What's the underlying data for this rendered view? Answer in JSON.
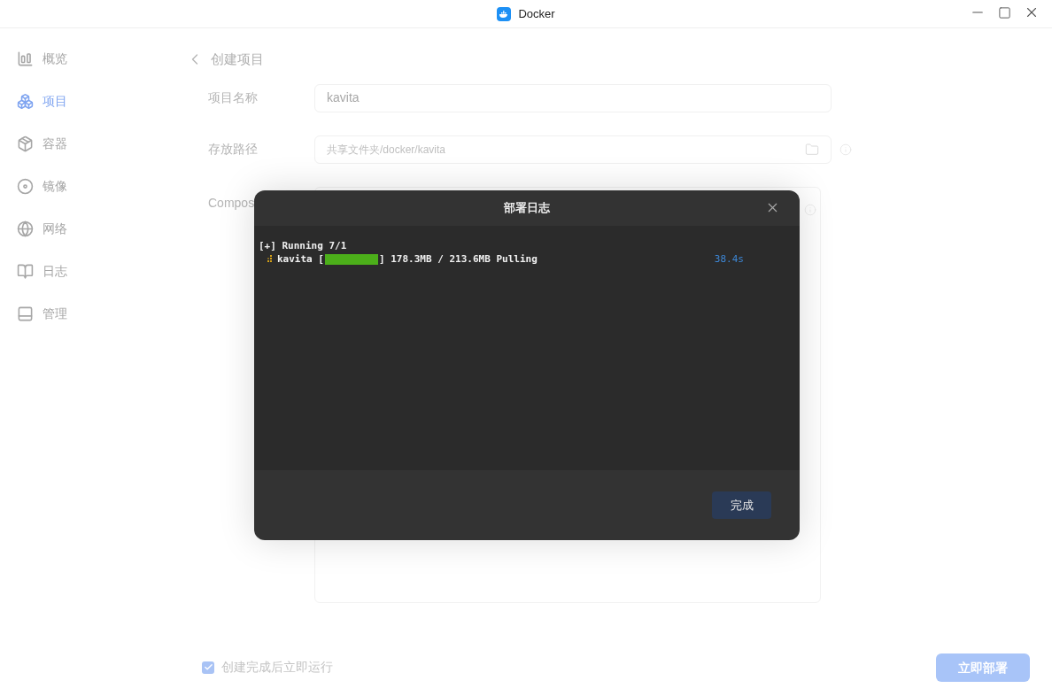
{
  "window": {
    "title": "Docker"
  },
  "sidebar": {
    "items": [
      {
        "label": "概览",
        "selected": false
      },
      {
        "label": "项目",
        "selected": true
      },
      {
        "label": "容器",
        "selected": false
      },
      {
        "label": "镜像",
        "selected": false
      },
      {
        "label": "网络",
        "selected": false
      },
      {
        "label": "日志",
        "selected": false
      },
      {
        "label": "管理",
        "selected": false
      }
    ]
  },
  "page": {
    "title": "创建项目",
    "fields": [
      {
        "label": "项目名称",
        "value": "kavita",
        "kind": "text"
      },
      {
        "label": "存放路径",
        "value": "共享文件夹/docker/kavita",
        "kind": "folder"
      }
    ],
    "compose_label": "Compos",
    "run_after_create": {
      "label": "创建完成后立即运行",
      "checked": true
    },
    "deploy_button": "立即部署"
  },
  "dialog": {
    "title": "部署日志",
    "log": [
      {
        "kind": "text",
        "text": "[+] Running 7/1"
      },
      {
        "kind": "progress",
        "name": "kavita [",
        "level": 1,
        "detail": "] 178.3MB / 213.6MB Pulling",
        "time": "38.4s"
      }
    ],
    "done_button": "完成"
  }
}
